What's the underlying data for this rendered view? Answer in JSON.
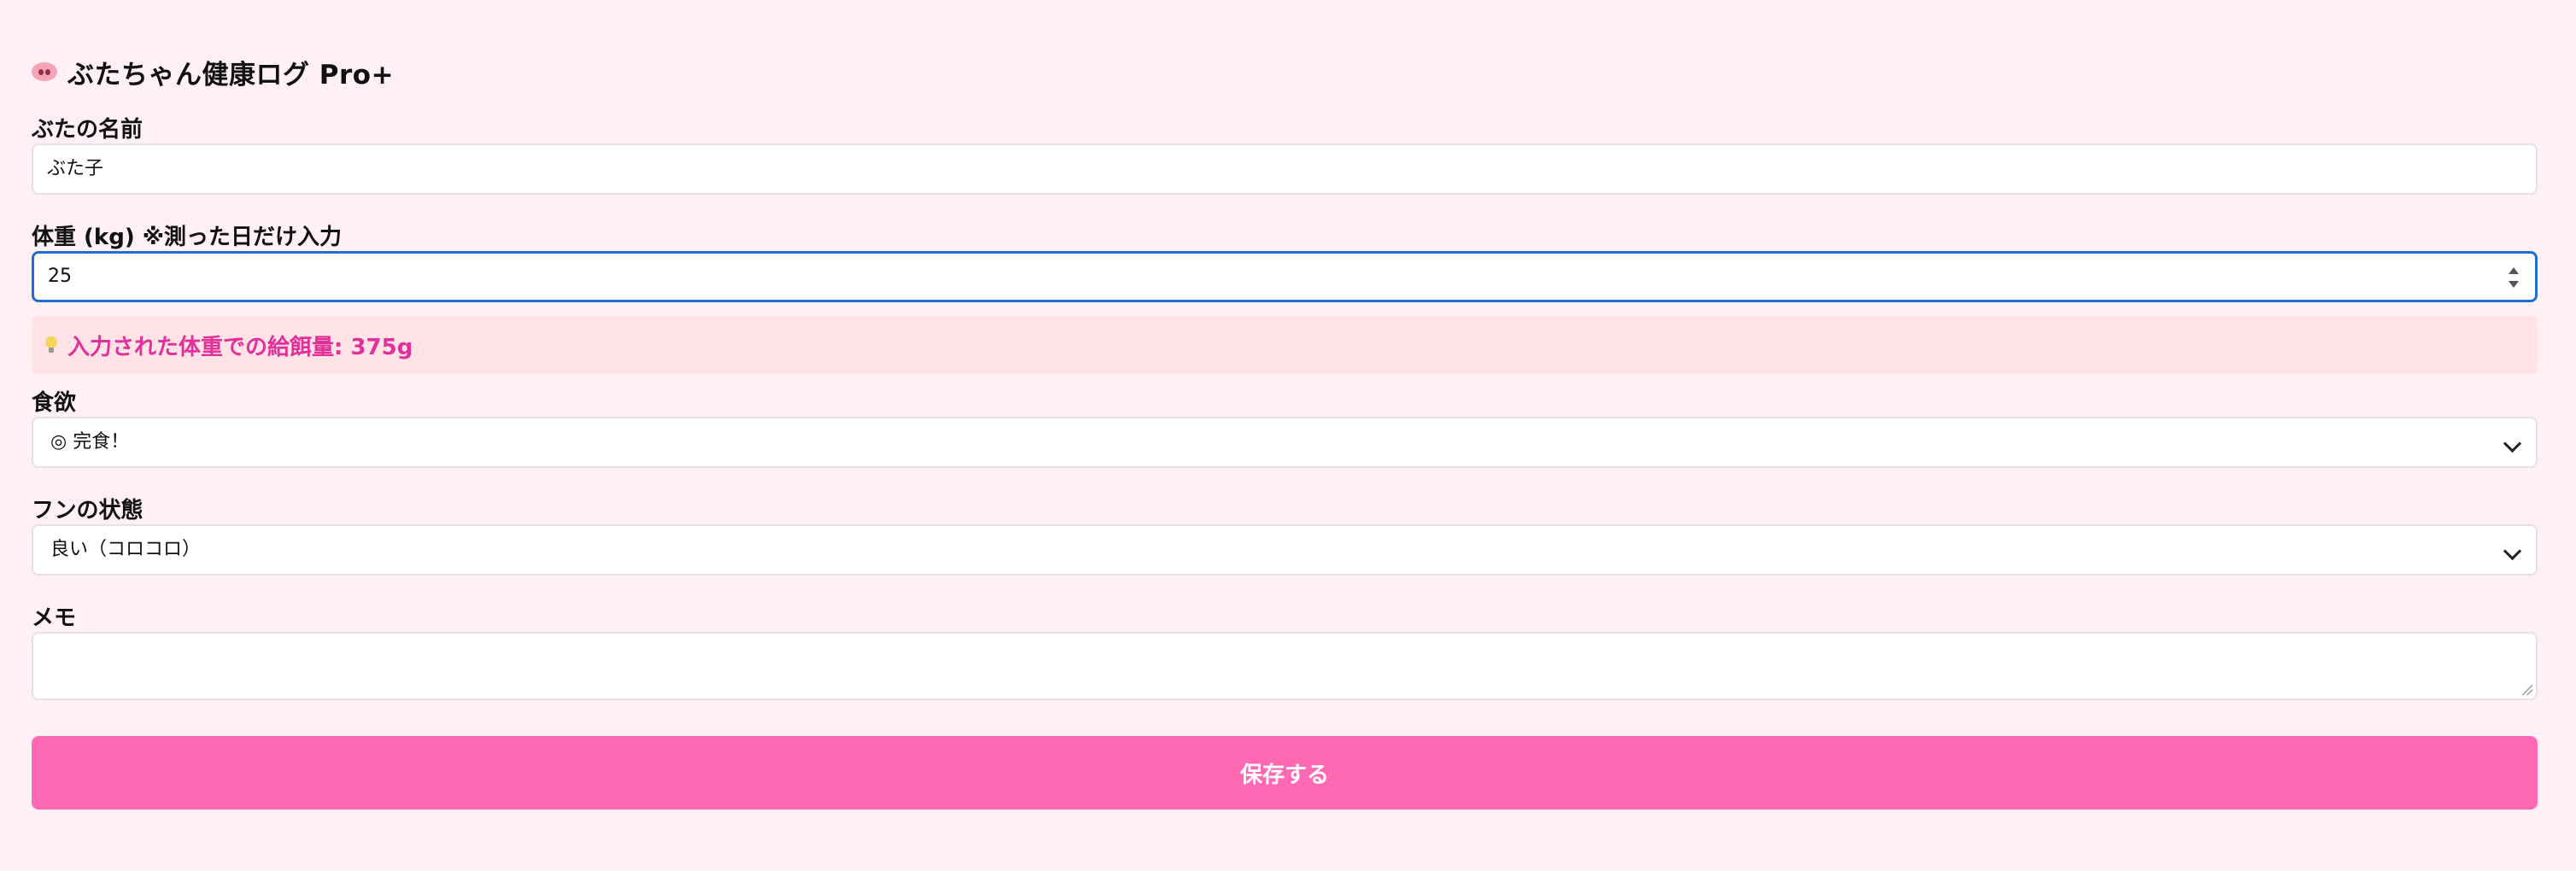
{
  "app": {
    "title": "ぶたちゃん健康ログ Pro+"
  },
  "form": {
    "name": {
      "label": "ぶたの名前",
      "value": "ぶた子"
    },
    "weight": {
      "label": "体重 (kg) ※測った日だけ入力",
      "value": "25"
    },
    "feed_hint": {
      "text": "入力された体重での給餌量: 375g"
    },
    "appetite": {
      "label": "食欲",
      "selected": "◎ 完食！"
    },
    "stool": {
      "label": "フンの状態",
      "selected": "良い（コロコロ）"
    },
    "memo": {
      "label": "メモ",
      "value": ""
    },
    "save_label": "保存する"
  },
  "icons": {
    "title": "pig-face-icon",
    "hint": "light-bulb-icon",
    "select": "chevron-down-icon"
  },
  "colors": {
    "background": "#fff0f5",
    "accent": "#ff69b4",
    "hint_bg": "#ffe3e6",
    "hint_text": "#e0309a",
    "focus": "#1f6fd1"
  }
}
